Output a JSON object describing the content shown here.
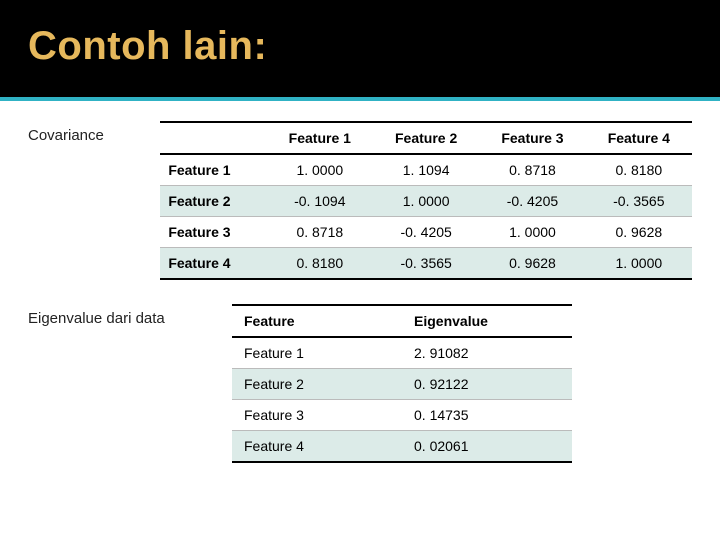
{
  "title": "Contoh lain:",
  "covariance": {
    "label": "Covariance",
    "columns": [
      "Feature 1",
      "Feature 2",
      "Feature 3",
      "Feature 4"
    ],
    "rows": [
      {
        "name": "Feature 1",
        "vals": [
          "1. 0000",
          "1. 1094",
          "0. 8718",
          "0. 8180"
        ]
      },
      {
        "name": "Feature 2",
        "vals": [
          "-0. 1094",
          "1. 0000",
          "-0. 4205",
          "-0. 3565"
        ]
      },
      {
        "name": "Feature 3",
        "vals": [
          "0. 8718",
          "-0. 4205",
          "1. 0000",
          "0. 9628"
        ]
      },
      {
        "name": "Feature 4",
        "vals": [
          "0. 8180",
          "-0. 3565",
          "0. 9628",
          "1. 0000"
        ]
      }
    ]
  },
  "eigenvalue": {
    "label": "Eigenvalue dari data",
    "columns": [
      "Feature",
      "Eigenvalue"
    ],
    "rows": [
      {
        "name": "Feature 1",
        "val": "2. 91082"
      },
      {
        "name": "Feature 2",
        "val": "0. 92122"
      },
      {
        "name": "Feature 3",
        "val": "0. 14735"
      },
      {
        "name": "Feature 4",
        "val": "0. 02061"
      }
    ]
  }
}
